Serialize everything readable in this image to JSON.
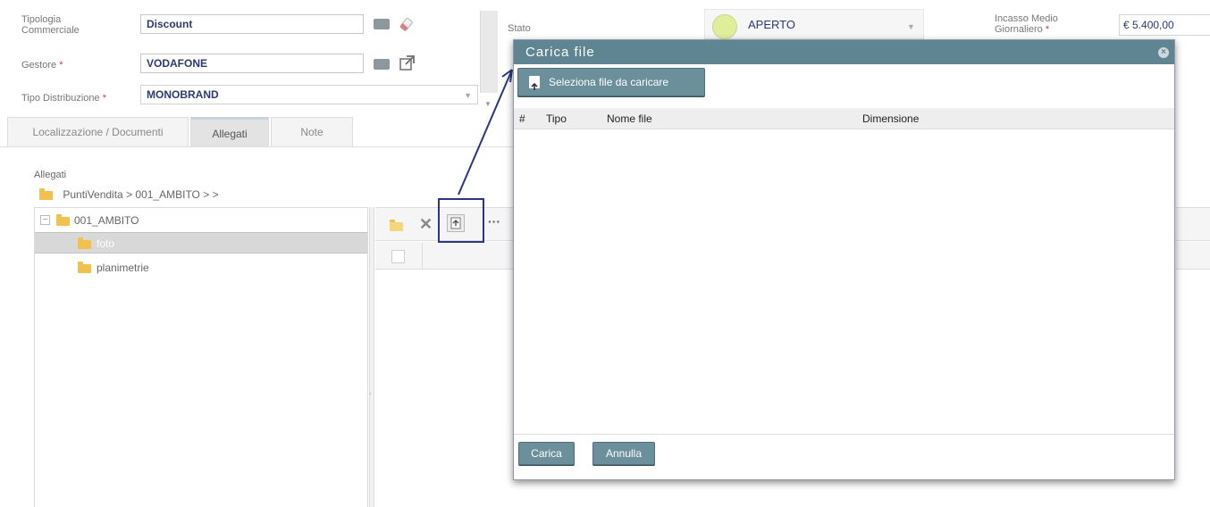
{
  "form": {
    "tipologia_label_1": "Tipologia",
    "tipologia_label_2": "Commerciale",
    "tipologia_value": "Discount",
    "gestore_label": "Gestore",
    "gestore_value": "VODAFONE",
    "tipo_distribuzione_label": "Tipo Distribuzione",
    "tipo_distribuzione_value": "MONOBRAND",
    "required_mark": "*",
    "stato_label": "Stato",
    "stato_value": "APERTO",
    "incasso_label_1": "Incasso Medio",
    "incasso_label_2": "Giornaliero",
    "incasso_value": "€ 5.400,00"
  },
  "tabs": [
    {
      "label": "Localizzazione / Documenti"
    },
    {
      "label": "Allegati"
    },
    {
      "label": "Note"
    }
  ],
  "attachments": {
    "section_label": "Allegati",
    "breadcrumb": "PuntiVendita > 001_AMBITO > >",
    "tree": {
      "root": "001_AMBITO",
      "children": [
        "foto",
        "planimetrie"
      ],
      "selected": "foto"
    }
  },
  "modal": {
    "title": "Carica file",
    "close_glyph": "×",
    "select_button": "Seleziona file da caricare",
    "columns": [
      "#",
      "Tipo",
      "Nome file",
      "Dimensione"
    ],
    "carica_button": "Carica",
    "annulla_button": "Annulla"
  },
  "colors": {
    "modal_header": "#5f8492",
    "button": "#6b8f9b",
    "highlight_box": "#2c3488",
    "status_circle": "#dfee9b",
    "folder": "#f0c24d"
  },
  "icons": {
    "tipologia_actions": [
      "card-icon",
      "eraser-icon"
    ],
    "gestore_actions": [
      "card-icon",
      "external-link-icon"
    ],
    "toolbar": [
      "new-folder-icon",
      "delete-icon",
      "upload-icon",
      "more-icon"
    ]
  }
}
